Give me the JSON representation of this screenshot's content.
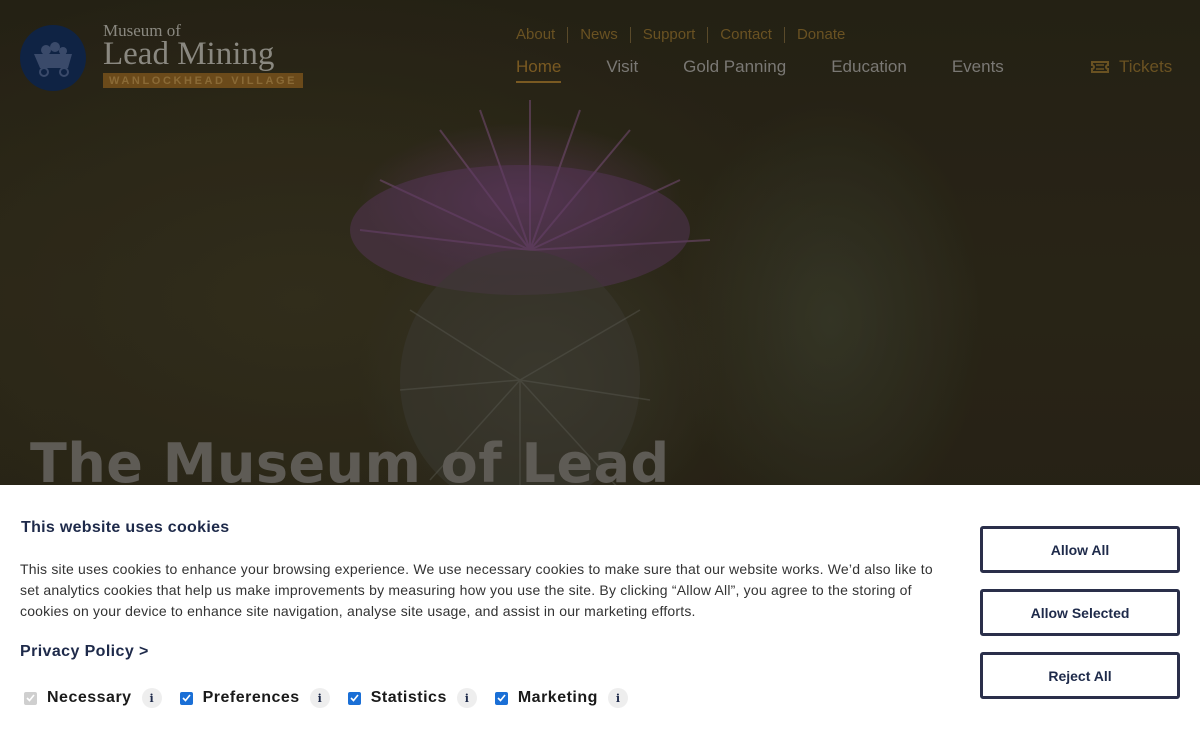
{
  "logo": {
    "line1": "Museum of",
    "line2": "Lead Mining",
    "line3": "WANLOCKHEAD VILLAGE"
  },
  "util_nav": [
    "About",
    "News",
    "Support",
    "Contact",
    "Donate"
  ],
  "main_nav": {
    "items": [
      "Home",
      "Visit",
      "Gold Panning",
      "Education",
      "Events"
    ],
    "active": "Home",
    "tickets": "Tickets"
  },
  "hero": {
    "title": "The Museum of Lead"
  },
  "cookie": {
    "title": "This website uses cookies",
    "body": "This site uses cookies to enhance your browsing experience. We use necessary cookies to make sure that our website works. We’d also like to set analytics cookies that help us make improvements by measuring how you use the site. By clicking “Allow All”, you agree to the storing of cookies on your device to enhance site navigation, analyse site usage, and assist in our marketing efforts.",
    "privacy_link": "Privacy Policy >",
    "options": [
      {
        "label": "Necessary",
        "checked": true,
        "disabled": true
      },
      {
        "label": "Preferences",
        "checked": true,
        "disabled": false
      },
      {
        "label": "Statistics",
        "checked": true,
        "disabled": false
      },
      {
        "label": "Marketing",
        "checked": true,
        "disabled": false
      }
    ],
    "info_glyph": "i",
    "buttons": {
      "allow_all": "Allow All",
      "allow_selected": "Allow Selected",
      "reject_all": "Reject All"
    }
  },
  "colors": {
    "navy": "#1e2a4a",
    "gold": "#7a5a22",
    "checkbox_blue": "#1a6fd6"
  }
}
